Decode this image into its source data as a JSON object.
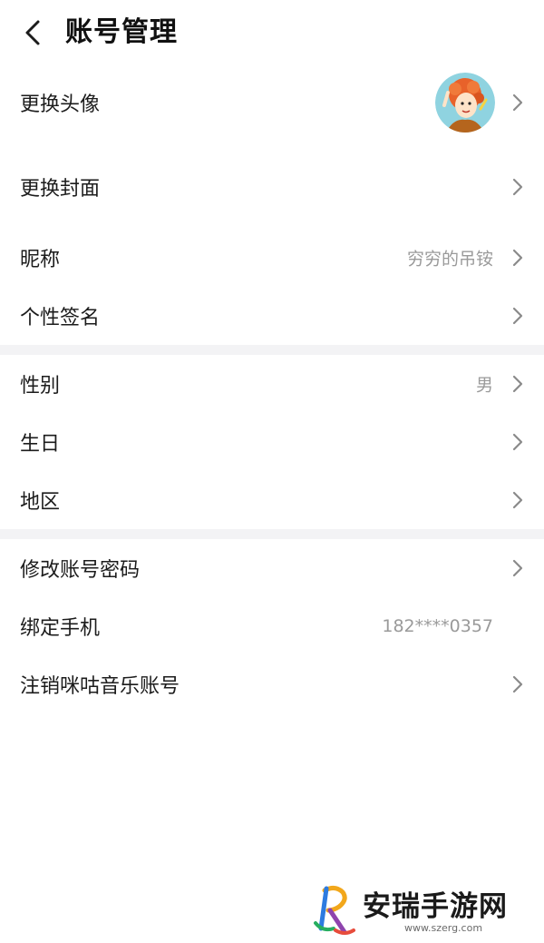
{
  "header": {
    "title": "账号管理",
    "back_icon": "chevron-left-icon"
  },
  "sections": {
    "profile": {
      "change_avatar": {
        "label": "更换头像"
      },
      "change_cover": {
        "label": "更换封面"
      },
      "nickname": {
        "label": "昵称",
        "value": "穷穷的吊铵"
      },
      "signature": {
        "label": "个性签名"
      }
    },
    "personal": {
      "gender": {
        "label": "性别",
        "value": "男"
      },
      "birthday": {
        "label": "生日"
      },
      "region": {
        "label": "地区"
      }
    },
    "account": {
      "change_password": {
        "label": "修改账号密码"
      },
      "bind_phone": {
        "label": "绑定手机",
        "value": "182****0357"
      },
      "deactivate": {
        "label": "注销咪咕音乐账号"
      }
    }
  },
  "watermark": {
    "title": "安瑞手游网",
    "url": "www.szerg.com"
  },
  "colors": {
    "text": "#1c1c1c",
    "secondary": "#9a9a9a",
    "divider": "#f3f3f5",
    "chevron": "#8a8a8a"
  }
}
